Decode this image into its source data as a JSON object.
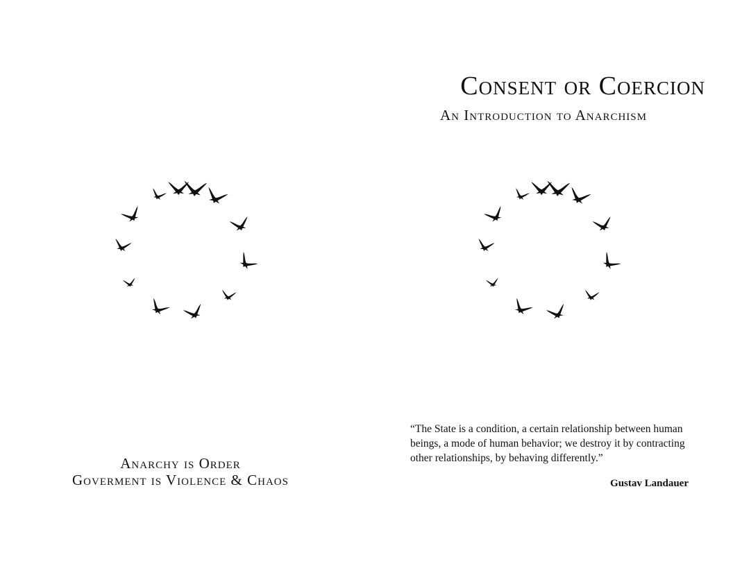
{
  "left_page": {
    "tagline": {
      "line1": "Anarchy is Order",
      "line2": "Goverment is Violence & Chaos"
    },
    "illustration": "flying-birds-ring"
  },
  "right_page": {
    "title": "Consent or Coercion",
    "subtitle": "An Introduction to Anarchism",
    "illustration": "flying-birds-ring",
    "quote": "“The State is a condition, a certain relationship between human beings, a mode of human behavior; we destroy it by contracting other relationships, by behaving differently.”",
    "author": "Gustav Landauer"
  },
  "colors": {
    "ink": "#111111",
    "paper": "#ffffff"
  }
}
